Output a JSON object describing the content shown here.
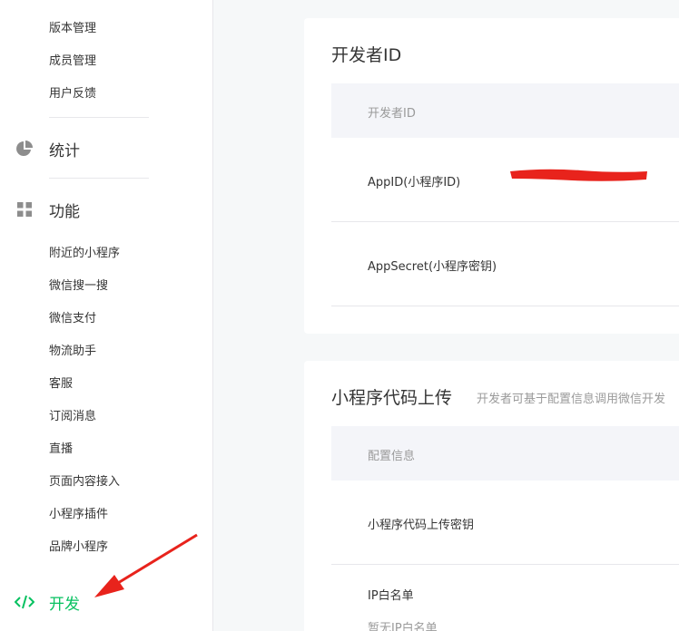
{
  "sidebar": {
    "top_items": [
      "版本管理",
      "成员管理",
      "用户反馈"
    ],
    "stats": {
      "label": "统计",
      "icon": "pie-chart-icon"
    },
    "features": {
      "label": "功能",
      "icon": "grid-icon",
      "items": [
        "附近的小程序",
        "微信搜一搜",
        "微信支付",
        "物流助手",
        "客服",
        "订阅消息",
        "直播",
        "页面内容接入",
        "小程序插件",
        "品牌小程序"
      ]
    },
    "develop": {
      "label": "开发",
      "icon": "code-icon",
      "active_color": "#07c160"
    }
  },
  "developer_id_card": {
    "title": "开发者ID",
    "table_header": "开发者ID",
    "rows": [
      {
        "label": "AppID(小程序ID)"
      },
      {
        "label": "AppSecret(小程序密钥)"
      }
    ]
  },
  "upload_card": {
    "title": "小程序代码上传",
    "desc": "开发者可基于配置信息调用微信开发",
    "table_header": "配置信息",
    "rows": [
      {
        "label": "小程序代码上传密钥"
      },
      {
        "label": "IP白名单",
        "sub": "暂无IP白名单"
      }
    ]
  },
  "colors": {
    "accent": "#07c160",
    "annotation": "#e8231c"
  }
}
